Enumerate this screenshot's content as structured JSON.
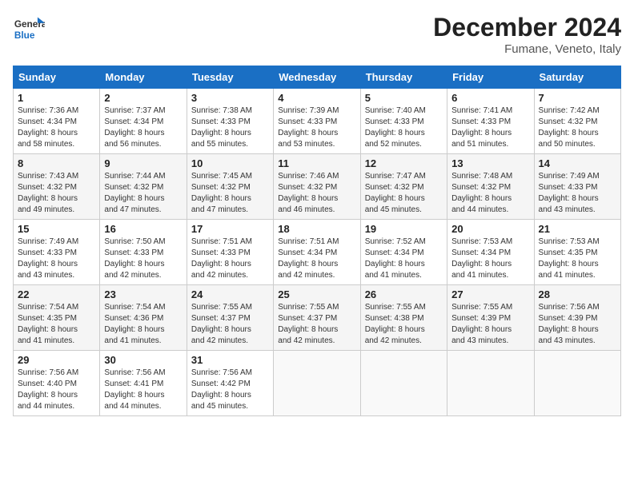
{
  "logo": {
    "general": "General",
    "blue": "Blue"
  },
  "header": {
    "month": "December 2024",
    "location": "Fumane, Veneto, Italy"
  },
  "weekdays": [
    "Sunday",
    "Monday",
    "Tuesday",
    "Wednesday",
    "Thursday",
    "Friday",
    "Saturday"
  ],
  "weeks": [
    [
      {
        "day": "1",
        "sunrise": "7:36 AM",
        "sunset": "4:34 PM",
        "daylight": "8 hours and 58 minutes."
      },
      {
        "day": "2",
        "sunrise": "7:37 AM",
        "sunset": "4:34 PM",
        "daylight": "8 hours and 56 minutes."
      },
      {
        "day": "3",
        "sunrise": "7:38 AM",
        "sunset": "4:33 PM",
        "daylight": "8 hours and 55 minutes."
      },
      {
        "day": "4",
        "sunrise": "7:39 AM",
        "sunset": "4:33 PM",
        "daylight": "8 hours and 53 minutes."
      },
      {
        "day": "5",
        "sunrise": "7:40 AM",
        "sunset": "4:33 PM",
        "daylight": "8 hours and 52 minutes."
      },
      {
        "day": "6",
        "sunrise": "7:41 AM",
        "sunset": "4:33 PM",
        "daylight": "8 hours and 51 minutes."
      },
      {
        "day": "7",
        "sunrise": "7:42 AM",
        "sunset": "4:32 PM",
        "daylight": "8 hours and 50 minutes."
      }
    ],
    [
      {
        "day": "8",
        "sunrise": "7:43 AM",
        "sunset": "4:32 PM",
        "daylight": "8 hours and 49 minutes."
      },
      {
        "day": "9",
        "sunrise": "7:44 AM",
        "sunset": "4:32 PM",
        "daylight": "8 hours and 47 minutes."
      },
      {
        "day": "10",
        "sunrise": "7:45 AM",
        "sunset": "4:32 PM",
        "daylight": "8 hours and 47 minutes."
      },
      {
        "day": "11",
        "sunrise": "7:46 AM",
        "sunset": "4:32 PM",
        "daylight": "8 hours and 46 minutes."
      },
      {
        "day": "12",
        "sunrise": "7:47 AM",
        "sunset": "4:32 PM",
        "daylight": "8 hours and 45 minutes."
      },
      {
        "day": "13",
        "sunrise": "7:48 AM",
        "sunset": "4:32 PM",
        "daylight": "8 hours and 44 minutes."
      },
      {
        "day": "14",
        "sunrise": "7:49 AM",
        "sunset": "4:33 PM",
        "daylight": "8 hours and 43 minutes."
      }
    ],
    [
      {
        "day": "15",
        "sunrise": "7:49 AM",
        "sunset": "4:33 PM",
        "daylight": "8 hours and 43 minutes."
      },
      {
        "day": "16",
        "sunrise": "7:50 AM",
        "sunset": "4:33 PM",
        "daylight": "8 hours and 42 minutes."
      },
      {
        "day": "17",
        "sunrise": "7:51 AM",
        "sunset": "4:33 PM",
        "daylight": "8 hours and 42 minutes."
      },
      {
        "day": "18",
        "sunrise": "7:51 AM",
        "sunset": "4:34 PM",
        "daylight": "8 hours and 42 minutes."
      },
      {
        "day": "19",
        "sunrise": "7:52 AM",
        "sunset": "4:34 PM",
        "daylight": "8 hours and 41 minutes."
      },
      {
        "day": "20",
        "sunrise": "7:53 AM",
        "sunset": "4:34 PM",
        "daylight": "8 hours and 41 minutes."
      },
      {
        "day": "21",
        "sunrise": "7:53 AM",
        "sunset": "4:35 PM",
        "daylight": "8 hours and 41 minutes."
      }
    ],
    [
      {
        "day": "22",
        "sunrise": "7:54 AM",
        "sunset": "4:35 PM",
        "daylight": "8 hours and 41 minutes."
      },
      {
        "day": "23",
        "sunrise": "7:54 AM",
        "sunset": "4:36 PM",
        "daylight": "8 hours and 41 minutes."
      },
      {
        "day": "24",
        "sunrise": "7:55 AM",
        "sunset": "4:37 PM",
        "daylight": "8 hours and 42 minutes."
      },
      {
        "day": "25",
        "sunrise": "7:55 AM",
        "sunset": "4:37 PM",
        "daylight": "8 hours and 42 minutes."
      },
      {
        "day": "26",
        "sunrise": "7:55 AM",
        "sunset": "4:38 PM",
        "daylight": "8 hours and 42 minutes."
      },
      {
        "day": "27",
        "sunrise": "7:55 AM",
        "sunset": "4:39 PM",
        "daylight": "8 hours and 43 minutes."
      },
      {
        "day": "28",
        "sunrise": "7:56 AM",
        "sunset": "4:39 PM",
        "daylight": "8 hours and 43 minutes."
      }
    ],
    [
      {
        "day": "29",
        "sunrise": "7:56 AM",
        "sunset": "4:40 PM",
        "daylight": "8 hours and 44 minutes."
      },
      {
        "day": "30",
        "sunrise": "7:56 AM",
        "sunset": "4:41 PM",
        "daylight": "8 hours and 44 minutes."
      },
      {
        "day": "31",
        "sunrise": "7:56 AM",
        "sunset": "4:42 PM",
        "daylight": "8 hours and 45 minutes."
      },
      null,
      null,
      null,
      null
    ]
  ],
  "labels": {
    "sunrise": "Sunrise:",
    "sunset": "Sunset:",
    "daylight": "Daylight hours"
  }
}
